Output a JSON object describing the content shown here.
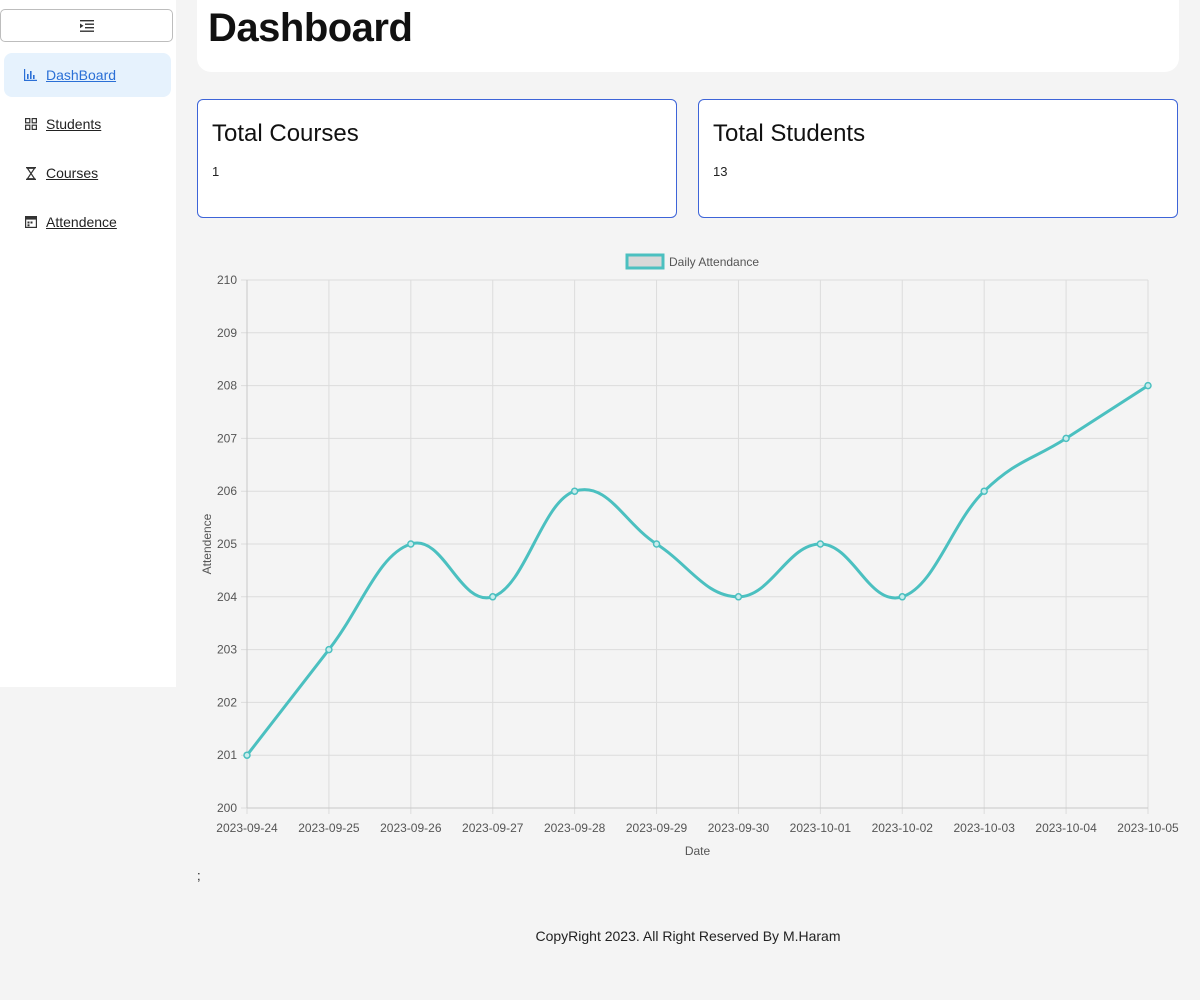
{
  "sidebar": {
    "items": [
      {
        "label": "DashBoard",
        "icon": "bar-chart-icon",
        "active": true
      },
      {
        "label": "Students",
        "icon": "grid-icon",
        "active": false
      },
      {
        "label": "Courses",
        "icon": "hourglass-icon",
        "active": false
      },
      {
        "label": "Attendence",
        "icon": "calendar-icon",
        "active": false
      }
    ]
  },
  "header": {
    "title": "Dashboard"
  },
  "cards": [
    {
      "title": "Total Courses",
      "value": "1"
    },
    {
      "title": "Total Students",
      "value": "13"
    }
  ],
  "chart_data": {
    "type": "line",
    "x": [
      "2023-09-24",
      "2023-09-25",
      "2023-09-26",
      "2023-09-27",
      "2023-09-28",
      "2023-09-29",
      "2023-09-30",
      "2023-10-01",
      "2023-10-02",
      "2023-10-03",
      "2023-10-04",
      "2023-10-05"
    ],
    "series": [
      {
        "name": "Daily Attendance",
        "values": [
          201,
          203,
          205,
          204,
          206,
          205,
          204,
          205,
          204,
          206,
          207,
          208
        ],
        "color": "#4bc0c0"
      }
    ],
    "xlabel": "Date",
    "ylabel": "Attendence",
    "ylim": [
      200,
      210
    ],
    "yticks": [
      200,
      201,
      202,
      203,
      204,
      205,
      206,
      207,
      208,
      209,
      210
    ],
    "grid": true,
    "legend": "top-center"
  },
  "misc": {
    "semicolon": ";"
  },
  "footer": {
    "text": "CopyRight 2023. All Right Reserved By M.Haram"
  }
}
